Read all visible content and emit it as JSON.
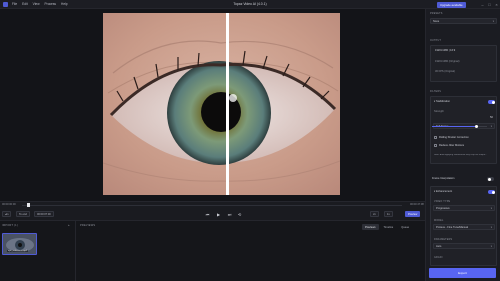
{
  "app": {
    "title": "Topaz Video AI (4.0.1)",
    "menu": [
      "File",
      "Edit",
      "View",
      "Process",
      "Help"
    ],
    "upgrade_label": "Upgrade available",
    "window_controls": [
      "minimize-icon",
      "maximize-icon",
      "close-icon"
    ]
  },
  "timeline": {
    "left_time": "00:00:00:00",
    "right_time": "00:00:47:08",
    "in_label": "In",
    "to_end_label": "To end",
    "end_time": "00:00:07:00",
    "zoom_label": "x1",
    "zoom_label2": "1x",
    "preview_label": "Preview"
  },
  "import_panel": {
    "title": "IMPORT (1)",
    "clip_label": "eye_reference.mp4"
  },
  "center_panel": {
    "title": "PREVIEWS",
    "tabs": [
      "Previews",
      "Timeline",
      "Queue"
    ]
  },
  "sidebar": {
    "presets_label": "PRESETS",
    "preset_value": "None",
    "output_label": "OUTPUT",
    "resolution": "1920×1080 | 16:9",
    "res_opt1": "1920×1080 (Original)",
    "res_opt2": "30 FPS (Original)",
    "filters_label": "FILTERS",
    "stabilization_label": "Stabilization",
    "strength_label": "Strength",
    "strength_value": "50",
    "strength_fraction": 0.8,
    "mode_value": "Full Frame",
    "rolling_shutter_label": "Rolling Shutter Correction",
    "reduce_motion_label": "Reduce Jitter Motions",
    "note_text": "Note: Auto-applying stabilization may crop the output...",
    "frame_interp_label": "Frame Interpolation",
    "enhancement_label": "Enhancement",
    "video_type_label": "VIDEO TYPE",
    "video_type_value": "Progressive",
    "model_label": "MODEL",
    "model_value": "Proteus - Fine Tune/Manual",
    "parameters_label": "PARAMETERS",
    "parameters_value": "Auto",
    "grain_label": "GRAIN",
    "grain_value": "",
    "export_label": "Export"
  },
  "colors": {
    "accent": "#5865f2",
    "background": "#16171c"
  }
}
